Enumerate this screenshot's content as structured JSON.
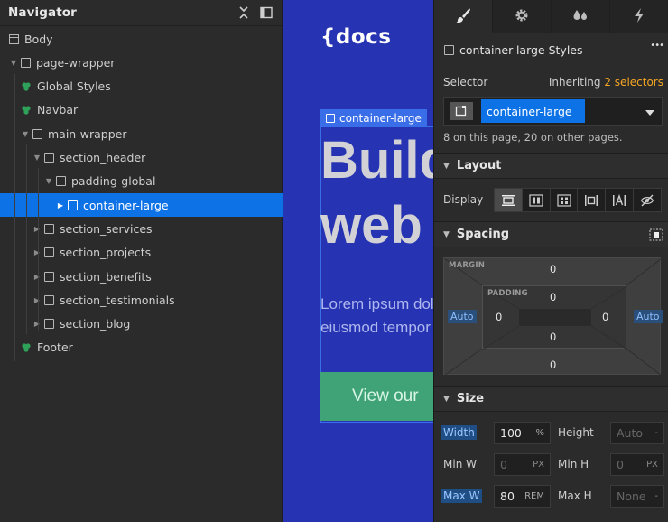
{
  "navigator": {
    "title": "Navigator",
    "tree": [
      {
        "label": "Body",
        "icon": "body-icon",
        "depth": 0,
        "arrow": "none",
        "type": "body"
      },
      {
        "label": "page-wrapper",
        "depth": 0,
        "arrow": "down",
        "type": "box"
      },
      {
        "label": "Global Styles",
        "depth": 1,
        "arrow": "none",
        "type": "symbol"
      },
      {
        "label": "Navbar",
        "depth": 1,
        "arrow": "none",
        "type": "symbol"
      },
      {
        "label": "main-wrapper",
        "depth": 1,
        "arrow": "down",
        "type": "box"
      },
      {
        "label": "section_header",
        "depth": 2,
        "arrow": "down",
        "type": "box"
      },
      {
        "label": "padding-global",
        "depth": 3,
        "arrow": "down",
        "type": "box"
      },
      {
        "label": "container-large",
        "depth": 4,
        "arrow": "right",
        "type": "box",
        "selected": true
      },
      {
        "label": "section_services",
        "depth": 2,
        "arrow": "right",
        "type": "box"
      },
      {
        "label": "section_projects",
        "depth": 2,
        "arrow": "right",
        "type": "box"
      },
      {
        "label": "section_benefits",
        "depth": 2,
        "arrow": "right",
        "type": "box"
      },
      {
        "label": "section_testimonials",
        "depth": 2,
        "arrow": "right",
        "type": "box"
      },
      {
        "label": "section_blog",
        "depth": 2,
        "arrow": "right",
        "type": "box"
      },
      {
        "label": "Footer",
        "depth": 1,
        "arrow": "none",
        "type": "symbol"
      }
    ]
  },
  "canvas": {
    "logo": "{docs",
    "selected_tag": "container-large",
    "hero_line1": "Build",
    "hero_line2": "web",
    "hero_text_line1": "Lorem ipsum dolor",
    "hero_text_line2": "eiusmod tempor",
    "hero_button": "View our"
  },
  "panel": {
    "tabs": [
      "brush-icon",
      "gear-icon",
      "drops-icon",
      "bolt-icon"
    ],
    "styles_title": "container-large Styles",
    "more": "•••",
    "selector_label": "Selector",
    "inheriting_label": "Inheriting",
    "inheriting_count": "2 selectors",
    "selector_chip": "container-large",
    "selector_info": "8 on this page, 20 on other pages.",
    "layout": {
      "title": "Layout",
      "display_label": "Display"
    },
    "spacing": {
      "title": "Spacing",
      "margin_caption": "MARGIN",
      "padding_caption": "PADDING",
      "margin_top": "0",
      "margin_bottom": "0",
      "margin_left": "Auto",
      "margin_right": "Auto",
      "padding_top": "0",
      "padding_bottom": "0",
      "padding_left": "0",
      "padding_right": "0"
    },
    "size": {
      "title": "Size",
      "width_label": "Width",
      "width_value": "100",
      "width_unit": "%",
      "height_label": "Height",
      "height_value": "Auto",
      "height_unit": "-",
      "minw_label": "Min W",
      "minw_value": "0",
      "minw_unit": "PX",
      "minh_label": "Min H",
      "minh_value": "0",
      "minh_unit": "PX",
      "maxw_label": "Max W",
      "maxw_value": "80",
      "maxw_unit": "REM",
      "maxh_label": "Max H",
      "maxh_value": "None",
      "maxh_unit": "-"
    }
  },
  "colors": {
    "accent": "#0d72e6",
    "canvas_bg": "#2633b2",
    "symbol_green": "#2fa25a",
    "inherit_orange": "#f5a623"
  }
}
